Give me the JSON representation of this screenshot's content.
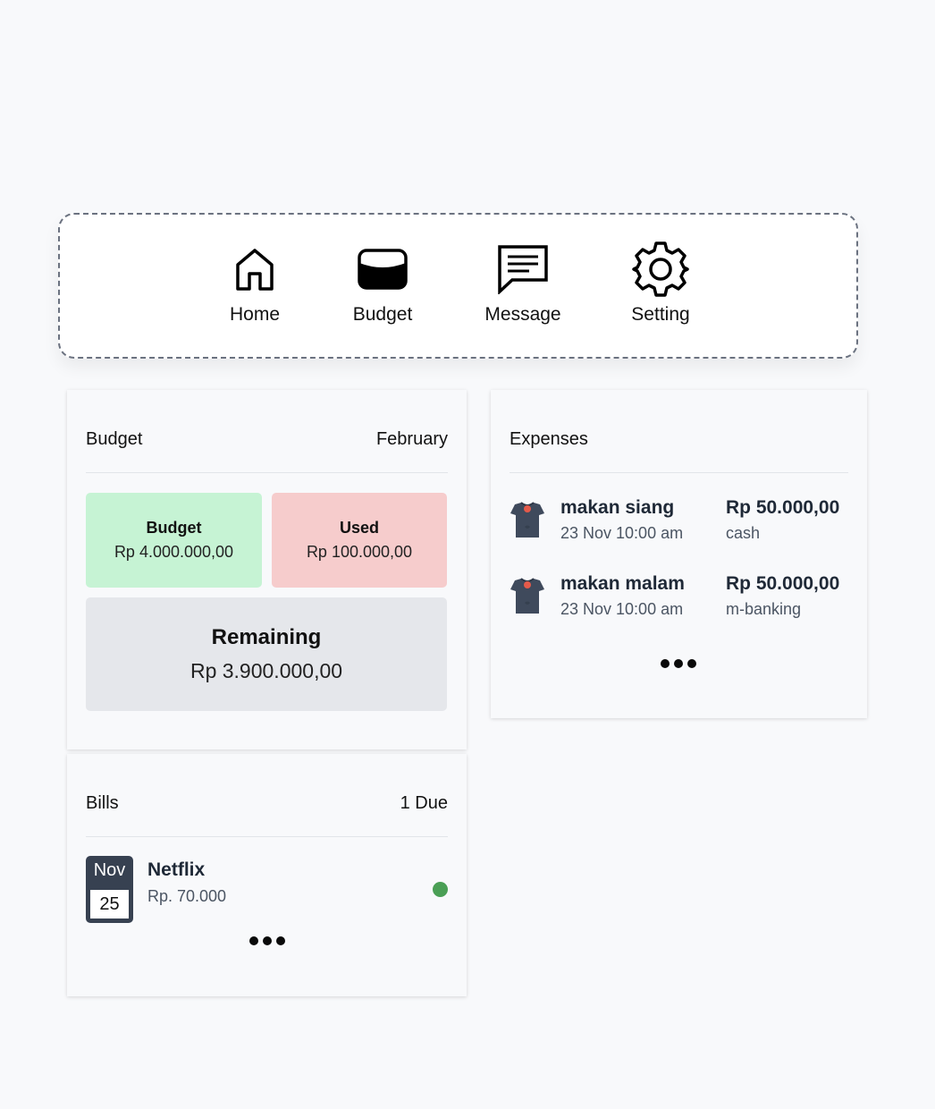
{
  "nav": {
    "items": [
      {
        "label": "Home",
        "icon": "home-icon"
      },
      {
        "label": "Budget",
        "icon": "wallet-icon"
      },
      {
        "label": "Message",
        "icon": "message-icon"
      },
      {
        "label": "Setting",
        "icon": "gear-icon"
      }
    ]
  },
  "budget_card": {
    "title": "Budget",
    "month": "February",
    "budget": {
      "label": "Budget",
      "value": "Rp 4.000.000,00",
      "color": "#c6f3d4"
    },
    "used": {
      "label": "Used",
      "value": "Rp 100.000,00",
      "color": "#f6cccc"
    },
    "remaining": {
      "label": "Remaining",
      "value": "Rp 3.900.000,00",
      "color": "#e5e7eb"
    }
  },
  "bills_card": {
    "title": "Bills",
    "due": "1 Due",
    "items": [
      {
        "month": "Nov",
        "day": "25",
        "name": "Netflix",
        "amount": "Rp. 70.000",
        "status_color": "#4a9f55"
      }
    ]
  },
  "expenses_card": {
    "title": "Expenses",
    "items": [
      {
        "title": "makan siang",
        "time": "23 Nov 10:00 am",
        "amount": "Rp 50.000,00",
        "method": "cash",
        "icon": "shirt-icon"
      },
      {
        "title": "makan malam",
        "time": "23 Nov 10:00 am",
        "amount": "Rp 50.000,00",
        "method": "m-banking",
        "icon": "shirt-icon"
      }
    ]
  }
}
